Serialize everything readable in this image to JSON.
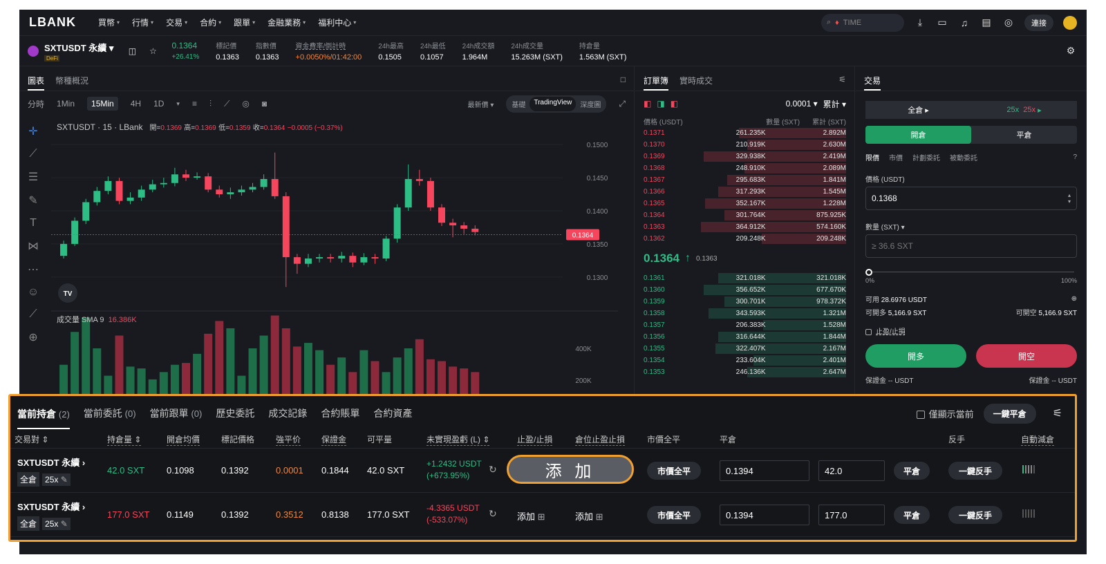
{
  "nav": {
    "logo": "LBANK",
    "items": [
      "買幣",
      "行情",
      "交易",
      "合約",
      "跟單",
      "金融業務",
      "福利中心"
    ],
    "search_text": "TIME",
    "connect": "連接"
  },
  "ticker": {
    "symbol": "SXTUSDT 永續",
    "tag": "DeFi",
    "price": "0.1364",
    "change": "+26.41%",
    "stats": [
      {
        "label": "標記價",
        "value": "0.1363"
      },
      {
        "label": "指數價",
        "value": "0.1363"
      },
      {
        "label": "資金費率/倒計時",
        "value": "+0.0050%/01:42:00"
      },
      {
        "label": "24h最高",
        "value": "0.1505"
      },
      {
        "label": "24h最低",
        "value": "0.1057"
      },
      {
        "label": "24h成交額",
        "value": "1.964M"
      },
      {
        "label": "24h成交量",
        "value": "15.263M (SXT)"
      },
      {
        "label": "持倉量",
        "value": "1.563M (SXT)"
      }
    ]
  },
  "chart": {
    "tabs": [
      "圖表",
      "幣種概況"
    ],
    "timeframes": [
      "分時",
      "1Min",
      "15Min",
      "4H",
      "1D"
    ],
    "latest": "最新價",
    "views": [
      "基礎",
      "TradingView",
      "深度圖"
    ],
    "ohlc_title": "SXTUSDT · 15 · LBank",
    "ohlc_open_label": "開=",
    "ohlc_open": "0.1369",
    "ohlc_high_label": "高=",
    "ohlc_high": "0.1369",
    "ohlc_low_label": "低=",
    "ohlc_low": "0.1359",
    "ohlc_close_label": "收=",
    "ohlc_close": "0.1364",
    "ohlc_change": "−0.0005 (−0.37%)",
    "price_axis": [
      "0.1500",
      "0.1450",
      "0.1400",
      "0.1350",
      "0.1300"
    ],
    "current_price": "0.1364",
    "volume_label": "成交量 SMA 9",
    "volume_value": "16.386K",
    "volume_axis": [
      "400K",
      "200K"
    ],
    "tv_badge": "TV"
  },
  "chart_data": {
    "type": "candlestick",
    "ylim": [
      0.128,
      0.152
    ],
    "candles": [
      {
        "o": 0.1332,
        "c": 0.135,
        "h": 0.1355,
        "l": 0.1328
      },
      {
        "o": 0.135,
        "c": 0.1385,
        "h": 0.139,
        "l": 0.1347
      },
      {
        "o": 0.1385,
        "c": 0.1413,
        "h": 0.1418,
        "l": 0.138
      },
      {
        "o": 0.1413,
        "c": 0.143,
        "h": 0.1436,
        "l": 0.1408
      },
      {
        "o": 0.143,
        "c": 0.1445,
        "h": 0.1452,
        "l": 0.1425
      },
      {
        "o": 0.1445,
        "c": 0.1415,
        "h": 0.145,
        "l": 0.141
      },
      {
        "o": 0.1415,
        "c": 0.142,
        "h": 0.1428,
        "l": 0.141
      },
      {
        "o": 0.142,
        "c": 0.1432,
        "h": 0.1438,
        "l": 0.1415
      },
      {
        "o": 0.1432,
        "c": 0.144,
        "h": 0.1447,
        "l": 0.1428
      },
      {
        "o": 0.144,
        "c": 0.1442,
        "h": 0.145,
        "l": 0.1435
      },
      {
        "o": 0.1442,
        "c": 0.1455,
        "h": 0.1465,
        "l": 0.1437
      },
      {
        "o": 0.1455,
        "c": 0.145,
        "h": 0.1462,
        "l": 0.1445
      },
      {
        "o": 0.145,
        "c": 0.1452,
        "h": 0.1458,
        "l": 0.1447
      },
      {
        "o": 0.1452,
        "c": 0.1432,
        "h": 0.1457,
        "l": 0.1428
      },
      {
        "o": 0.1432,
        "c": 0.1425,
        "h": 0.1438,
        "l": 0.142
      },
      {
        "o": 0.1425,
        "c": 0.1428,
        "h": 0.1435,
        "l": 0.1418
      },
      {
        "o": 0.1428,
        "c": 0.1432,
        "h": 0.1438,
        "l": 0.1423
      },
      {
        "o": 0.1432,
        "c": 0.1436,
        "h": 0.1442,
        "l": 0.1428
      },
      {
        "o": 0.1436,
        "c": 0.1448,
        "h": 0.1455,
        "l": 0.1432
      },
      {
        "o": 0.1448,
        "c": 0.1422,
        "h": 0.1488,
        "l": 0.1418
      },
      {
        "o": 0.1422,
        "c": 0.133,
        "h": 0.1428,
        "l": 0.1285
      },
      {
        "o": 0.133,
        "c": 0.132,
        "h": 0.1335,
        "l": 0.1305
      },
      {
        "o": 0.132,
        "c": 0.1328,
        "h": 0.1335,
        "l": 0.1315
      },
      {
        "o": 0.1328,
        "c": 0.133,
        "h": 0.1335,
        "l": 0.1322
      },
      {
        "o": 0.133,
        "c": 0.1328,
        "h": 0.1335,
        "l": 0.1322
      },
      {
        "o": 0.1328,
        "c": 0.1332,
        "h": 0.1338,
        "l": 0.1322
      },
      {
        "o": 0.1332,
        "c": 0.1322,
        "h": 0.1337,
        "l": 0.1315
      },
      {
        "o": 0.1322,
        "c": 0.133,
        "h": 0.1336,
        "l": 0.1318
      },
      {
        "o": 0.133,
        "c": 0.1328,
        "h": 0.1335,
        "l": 0.132
      },
      {
        "o": 0.1328,
        "c": 0.1358,
        "h": 0.1362,
        "l": 0.1324
      },
      {
        "o": 0.1358,
        "c": 0.1405,
        "h": 0.141,
        "l": 0.1352
      },
      {
        "o": 0.1405,
        "c": 0.1448,
        "h": 0.147,
        "l": 0.14
      },
      {
        "o": 0.1448,
        "c": 0.1445,
        "h": 0.1462,
        "l": 0.1438
      },
      {
        "o": 0.1445,
        "c": 0.1405,
        "h": 0.145,
        "l": 0.14
      },
      {
        "o": 0.1405,
        "c": 0.1382,
        "h": 0.141,
        "l": 0.1377
      },
      {
        "o": 0.1382,
        "c": 0.1378,
        "h": 0.1388,
        "l": 0.136
      },
      {
        "o": 0.1378,
        "c": 0.1373,
        "h": 0.1383,
        "l": 0.1365
      },
      {
        "o": 0.1373,
        "c": 0.1368,
        "h": 0.1378,
        "l": 0.1363
      }
    ],
    "volumes": [
      160,
      340,
      420,
      250,
      100,
      320,
      150,
      140,
      80,
      120,
      160,
      170,
      220,
      330,
      400,
      360,
      100,
      250,
      320,
      430,
      360,
      260,
      280,
      240,
      160,
      200,
      120,
      240,
      180,
      120,
      200,
      250,
      300,
      190,
      180,
      150,
      140,
      120
    ],
    "volume_ylim": [
      0,
      500
    ]
  },
  "orderbook": {
    "tabs": [
      "訂單簿",
      "實時成交"
    ],
    "tick": "0.0001",
    "mode": "累計",
    "cols": [
      "價格 (USDT)",
      "數量 (SXT)",
      "累計 (SXT)"
    ],
    "asks": [
      {
        "p": "0.1371",
        "q": "261.235K",
        "t": "2.892M",
        "depth": 0.74
      },
      {
        "p": "0.1370",
        "q": "210.919K",
        "t": "2.630M",
        "depth": 0.68
      },
      {
        "p": "0.1369",
        "q": "329.938K",
        "t": "2.419M",
        "depth": 0.98
      },
      {
        "p": "0.1368",
        "q": "248.910K",
        "t": "2.089M",
        "depth": 0.7
      },
      {
        "p": "0.1367",
        "q": "295.683K",
        "t": "1.841M",
        "depth": 0.82
      },
      {
        "p": "0.1366",
        "q": "317.293K",
        "t": "1.545M",
        "depth": 0.88
      },
      {
        "p": "0.1365",
        "q": "352.167K",
        "t": "1.228M",
        "depth": 0.97
      },
      {
        "p": "0.1364",
        "q": "301.764K",
        "t": "875.925K",
        "depth": 0.84
      },
      {
        "p": "0.1363",
        "q": "364.912K",
        "t": "574.160K",
        "depth": 1.0
      },
      {
        "p": "0.1362",
        "q": "209.248K",
        "t": "209.248K",
        "depth": 0.58
      }
    ],
    "mid_price": "0.1364",
    "mid_arrow": "↑",
    "mark": "0.1363",
    "bids": [
      {
        "p": "0.1361",
        "q": "321.018K",
        "t": "321.018K",
        "depth": 0.88
      },
      {
        "p": "0.1360",
        "q": "356.652K",
        "t": "677.670K",
        "depth": 0.98
      },
      {
        "p": "0.1359",
        "q": "300.701K",
        "t": "978.372K",
        "depth": 0.84
      },
      {
        "p": "0.1358",
        "q": "343.593K",
        "t": "1.321M",
        "depth": 0.95
      },
      {
        "p": "0.1357",
        "q": "206.383K",
        "t": "1.528M",
        "depth": 0.57
      },
      {
        "p": "0.1356",
        "q": "316.644K",
        "t": "1.844M",
        "depth": 0.88
      },
      {
        "p": "0.1355",
        "q": "322.407K",
        "t": "2.167M",
        "depth": 0.9
      },
      {
        "p": "0.1354",
        "q": "233.604K",
        "t": "2.401M",
        "depth": 0.64
      },
      {
        "p": "0.1353",
        "q": "246.136K",
        "t": "2.647M",
        "depth": 0.68
      }
    ]
  },
  "trade": {
    "title": "交易",
    "margin_mode": "全倉",
    "leverage": "25x",
    "leverage2": "25x",
    "open_tab": "開倉",
    "close_tab": "平倉",
    "order_types": [
      "限價",
      "市價",
      "計劃委託",
      "被動委託"
    ],
    "price_label": "價格 (USDT)",
    "price_value": "0.1368",
    "qty_label": "數量 (SXT)",
    "qty_placeholder": "≥ 36.6 SXT",
    "slider_min": "0%",
    "slider_max": "100%",
    "avail_label": "可用",
    "avail_value": "28.6976 USDT",
    "can_long_label": "可開多",
    "can_long_value": "5,166.9 SXT",
    "can_short_label": "可開空",
    "can_short_value": "5,166.9 SXT",
    "tpsl": "止盈/止損",
    "long_btn": "開多",
    "short_btn": "開空",
    "margin_label_l": "保證金 --  USDT",
    "margin_label_r": "保證金 --  USDT"
  },
  "positions": {
    "tabs": [
      {
        "label": "當前持倉",
        "count": "(2)"
      },
      {
        "label": "當前委託",
        "count": "(0)"
      },
      {
        "label": "當前跟單",
        "count": "(0)"
      },
      {
        "label": "歷史委託",
        "count": ""
      },
      {
        "label": "成交記錄",
        "count": ""
      },
      {
        "label": "合約賬單",
        "count": ""
      },
      {
        "label": "合約資產",
        "count": ""
      }
    ],
    "only_current": "僅顯示當前",
    "close_all": "一鍵平倉",
    "headers": [
      "交易對",
      "持倉量",
      "開倉均價",
      "標記價格",
      "強平价",
      "保證金",
      "可平量",
      "未實現盈虧 (L)",
      "止盈/止損",
      "倉位止盈止損",
      "市價全平",
      "平倉",
      "反手",
      "自動減倉"
    ],
    "rows": [
      {
        "symbol": "SXTUSDT 永續",
        "mode": "全倉",
        "lev": "25x",
        "qty": "42.0 SXT",
        "qty_side": "long",
        "entry": "0.1098",
        "mark": "0.1392",
        "liq": "0.0001",
        "margin": "0.1844",
        "closable": "42.0 SXT",
        "pnl": "+1.2432 USDT",
        "pnl_pct": "(+673.95%)",
        "pnl_side": "up",
        "tpsl": "添 加",
        "pos_tpsl": "",
        "market_close": "市價全平",
        "close_price": "0.1394",
        "close_qty": "42.0",
        "close_btn": "平倉",
        "reverse": "一鍵反手",
        "adl_level": 0.8
      },
      {
        "symbol": "SXTUSDT 永續",
        "mode": "全倉",
        "lev": "25x",
        "qty": "177.0 SXT",
        "qty_side": "short",
        "entry": "0.1149",
        "mark": "0.1392",
        "liq": "0.3512",
        "margin": "0.8138",
        "closable": "177.0 SXT",
        "pnl": "-4.3365 USDT",
        "pnl_pct": "(-533.07%)",
        "pnl_side": "down",
        "tpsl": "添加",
        "pos_tpsl": "添加",
        "market_close": "市價全平",
        "close_price": "0.1394",
        "close_qty": "177.0",
        "close_btn": "平倉",
        "reverse": "一鍵反手",
        "adl_level": 0.0
      }
    ]
  },
  "colors": {
    "up": "#2ebd85",
    "down": "#f6465d",
    "accent": "#f0a030",
    "bg": "#181a1f"
  }
}
